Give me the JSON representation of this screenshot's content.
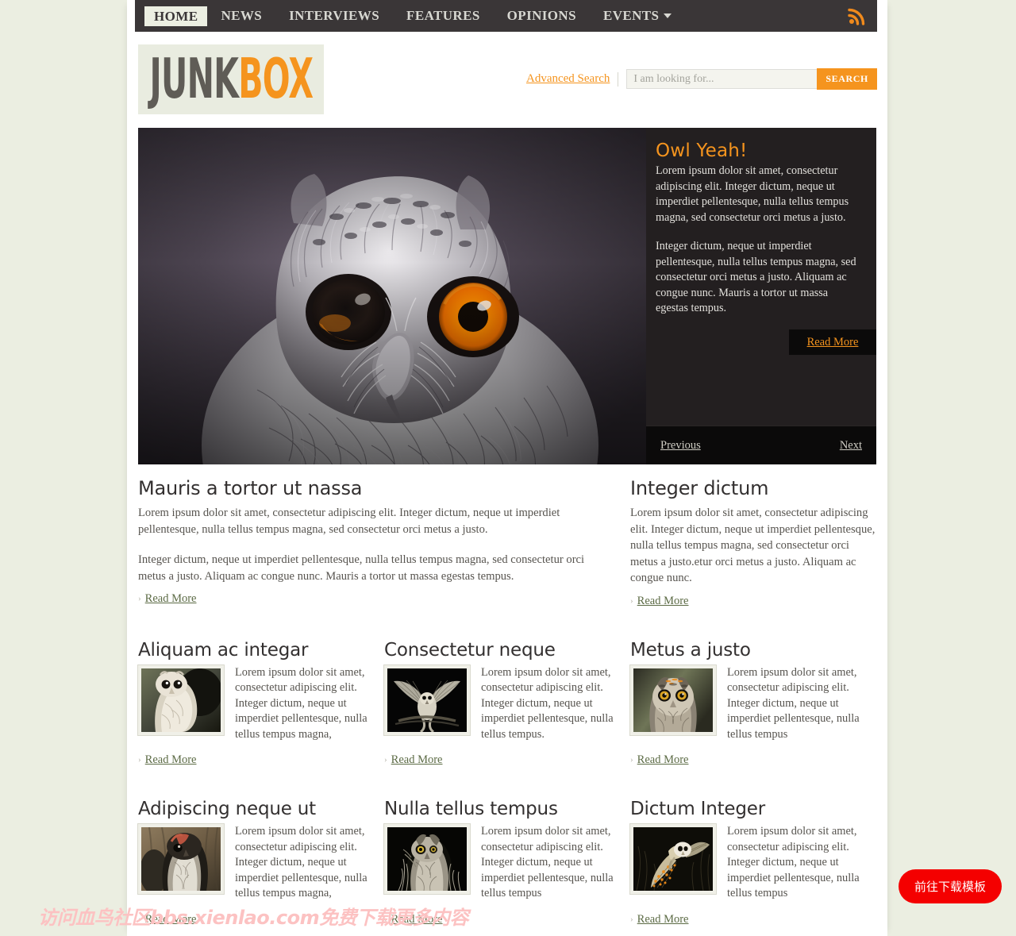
{
  "site": {
    "logo_junk": "JUNK",
    "logo_box": "BOX"
  },
  "nav": {
    "items": [
      {
        "label": "HOME",
        "active": true,
        "caret": false
      },
      {
        "label": "NEWS",
        "active": false,
        "caret": false
      },
      {
        "label": "INTERVIEWS",
        "active": false,
        "caret": false
      },
      {
        "label": "FEATURES",
        "active": false,
        "caret": false
      },
      {
        "label": "OPINIONS",
        "active": false,
        "caret": false
      },
      {
        "label": "EVENTS",
        "active": false,
        "caret": true
      }
    ],
    "rss_icon": "rss-icon"
  },
  "search": {
    "advanced_label": "Advanced Search",
    "placeholder": "I am looking for...",
    "value": "",
    "button_label": "SEARCH"
  },
  "hero": {
    "title": "Owl Yeah!",
    "paragraph1": "Lorem ipsum dolor sit amet, consectetur adipiscing elit. Integer dictum, neque ut imperdiet pellentesque, nulla tellus tempus magna, sed consectetur orci metus a justo.",
    "paragraph2": "Integer dictum, neque ut imperdiet pellentesque, nulla tellus tempus magna, sed consectetur orci metus a justo. Aliquam ac congue nunc. Mauris a tortor ut massa egestas tempus.",
    "read_more": "Read More",
    "previous": "Previous",
    "next": "Next"
  },
  "main_article": {
    "title": "Mauris a tortor ut nassa",
    "paragraph1": "Lorem ipsum dolor sit amet, consectetur adipiscing elit. Integer dictum, neque ut imperdiet pellentesque, nulla tellus tempus magna, sed consectetur orci metus a justo.",
    "paragraph2": "Integer dictum, neque ut imperdiet pellentesque, nulla tellus tempus magna, sed consectetur orci metus a justo. Aliquam ac congue nunc. Mauris a tortor ut massa egestas tempus.",
    "read_more": "Read More"
  },
  "side_article": {
    "title": "Integer dictum",
    "paragraph1": "Lorem ipsum dolor sit amet, consectetur adipiscing elit. Integer dictum, neque ut imperdiet pellentesque, nulla tellus tempus magna, sed consectetur orci metus a justo.etur orci metus a justo. Aliquam ac congue nunc.",
    "read_more": "Read More"
  },
  "grid": {
    "read_more": "Read More",
    "row1": [
      {
        "title": "Aliquam ac integar",
        "text": "Lorem ipsum dolor sit amet, consectetur adipiscing elit. Integer dictum, neque ut imperdiet pellentesque, nulla tellus tempus magna,",
        "thumb": "owl-screech-perched"
      },
      {
        "title": "Consectetur neque",
        "text": "Lorem ipsum dolor sit amet, consectetur adipiscing elit. Integer dictum, neque ut imperdiet pellentesque, nulla tellus tempus.",
        "thumb": "owl-flying-wings-spread"
      },
      {
        "title": "Metus a justo",
        "text": "Lorem ipsum dolor sit amet, consectetur adipiscing elit. Integer dictum, neque ut imperdiet pellentesque, nulla tellus tempus",
        "thumb": "owl-great-horned-face"
      }
    ],
    "row2": [
      {
        "title": "Adipiscing neque ut",
        "text": "Lorem ipsum dolor sit amet, consectetur adipiscing elit. Integer dictum, neque ut imperdiet pellentesque, nulla tellus tempus magna,",
        "thumb": "owl-screech-brown"
      },
      {
        "title": "Nulla tellus tempus",
        "text": "Lorem ipsum dolor sit amet, consectetur adipiscing elit. Integer dictum, neque ut imperdiet pellentesque, nulla tellus tempus",
        "thumb": "owl-horned-night"
      },
      {
        "title": "Dictum Integer",
        "text": "Lorem ipsum dolor sit amet, consectetur adipiscing elit. Integer dictum, neque ut imperdiet pellentesque, nulla tellus tempus",
        "thumb": "owl-barn-flight"
      }
    ]
  },
  "overlay": {
    "watermark": "访问血鸟社区bbs.xienlao.com免费下载更多内容",
    "download_button": "前往下载模板"
  },
  "colors": {
    "accent_orange": "#f5941e",
    "nav_dark": "#3a3637",
    "page_bg": "#ebeee1",
    "link_green": "#5c6b45",
    "button_red": "#f40000"
  }
}
